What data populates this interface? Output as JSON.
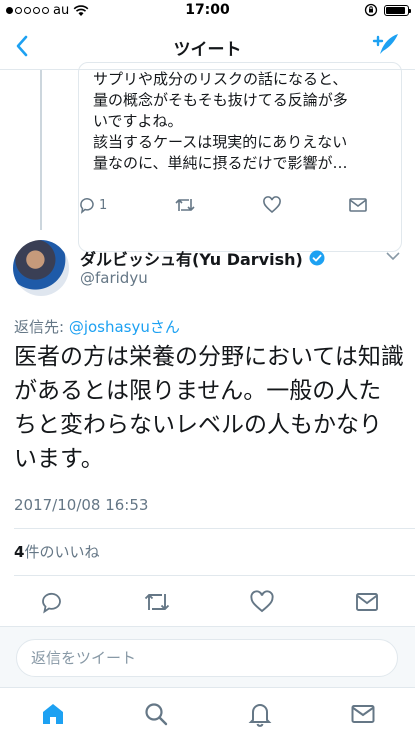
{
  "status_bar": {
    "carrier": "au",
    "time": "17:00"
  },
  "navbar": {
    "title": "ツイート"
  },
  "quoted": {
    "text": "サプリや成分のリスクの話になると、\n量の概念がそもそも抜けてる反論が多\nいですよね。\n該当するケースは現実的にありえない\n量なのに、単純に摂るだけで影響が…",
    "reply_count": "1"
  },
  "tweet": {
    "author_name": "ダルビッシュ有(Yu Darvish)",
    "author_handle": "@faridyu",
    "reply_to_prefix": "返信先: ",
    "reply_to_user": "@joshasyuさん",
    "text": "医者の方は栄養の分野においては知識があるとは限りません。一般の人たちと変わらないレベルの人もかなりいます。",
    "timestamp": "2017/10/08 16:53",
    "likes_count": "4",
    "likes_label": "件のいいね"
  },
  "reply_bar": {
    "placeholder": "返信をツイート"
  },
  "colors": {
    "accent": "#1da1f2",
    "muted": "#657786",
    "border": "#e1e8ed"
  },
  "icons": {
    "back": "chevron-left-icon",
    "compose": "compose-tweet-icon",
    "reply": "reply-icon",
    "retweet": "retweet-icon",
    "like": "heart-icon",
    "dm": "envelope-icon",
    "home": "home-icon",
    "search": "search-icon",
    "notifications": "bell-icon",
    "messages": "envelope-icon"
  }
}
